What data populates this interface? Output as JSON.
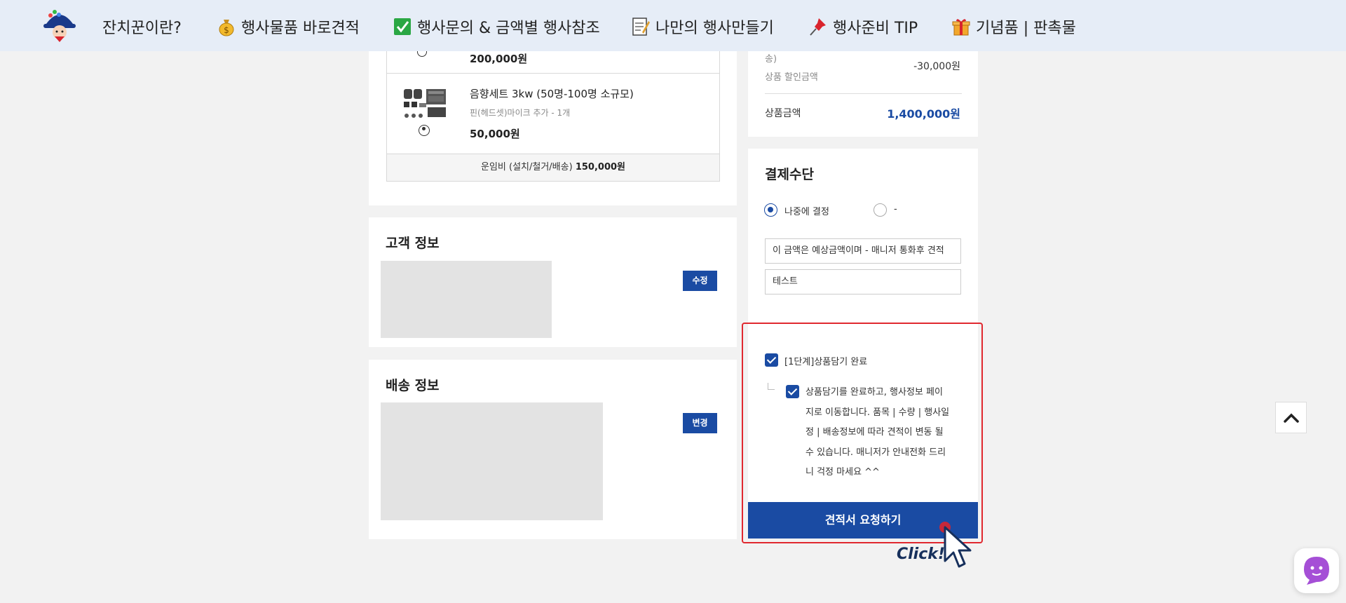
{
  "nav": {
    "items": [
      {
        "label": "잔치꾼이란?",
        "icon": "none"
      },
      {
        "label": "행사물품 바로견적",
        "icon": "money-bag-icon"
      },
      {
        "label": "행사문의 & 금액별 행사참조",
        "icon": "check-box-icon"
      },
      {
        "label": "나만의 행사만들기",
        "icon": "memo-icon"
      },
      {
        "label": "행사준비 TIP",
        "icon": "pushpin-icon"
      },
      {
        "label": "기념품 | 판촉물",
        "icon": "gift-icon"
      }
    ]
  },
  "cart": {
    "prev_item_price": "200,000원",
    "item": {
      "name": "음향세트 3kw (50명-100명 소규모)",
      "option": "핀(헤드셋)마이크 추가 - 1개",
      "price": "50,000원"
    },
    "freight_label": "운임비 (설치/철거/배송)",
    "freight_value": "150,000원"
  },
  "customer": {
    "title": "고객 정보",
    "edit_label": "수정"
  },
  "delivery": {
    "title": "배송 정보",
    "change_label": "변경"
  },
  "summary": {
    "prev_fragment": "송)",
    "discount_label": "상품 할인금액",
    "discount_value": "-30,000원",
    "total_label": "상품금액",
    "total_value": "1,400,000원"
  },
  "payment": {
    "title": "결제수단",
    "option1": "나중에 결정",
    "option2": "-",
    "notice_text": "이 금액은 예상금액이며 - 매니저 통화후 견적",
    "memo_text": "테스트"
  },
  "agreement": {
    "step1_label": "[1단계]상품담기 완료",
    "lines": [
      "상품담기를 완료하고, 행사정보 페이",
      "지로 이동합니다. 품목 | 수량 | 행사일",
      "정 | 배송정보에 따라 견적이 변동 될",
      "수 있습니다. 매니저가 안내전화 드리",
      "니 걱정 마세요 ^^"
    ]
  },
  "cta": {
    "label": "견적서 요청하기"
  },
  "annotation": {
    "click_label": "Click!"
  },
  "colors": {
    "brand_blue": "#1a4ba3",
    "highlight_red": "#e0282f",
    "nav_bg": "#e6edf7"
  }
}
